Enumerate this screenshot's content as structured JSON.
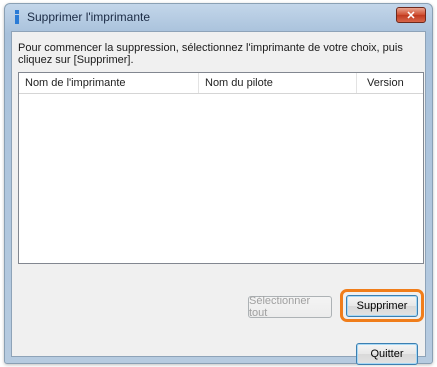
{
  "window": {
    "title": "Supprimer l'imprimante",
    "close_label": "✕"
  },
  "instruction": "Pour commencer la suppression, sélectionnez l'imprimante de votre choix, puis cliquez sur [Supprimer].",
  "printer_list": {
    "columns": [
      "Nom de l'imprimante",
      "Nom du pilote",
      "Version"
    ],
    "rows": []
  },
  "buttons": {
    "select_all": "Sélectionner tout",
    "delete": "Supprimer",
    "quit": "Quitter"
  },
  "colors": {
    "highlight": "#f07d1a"
  }
}
